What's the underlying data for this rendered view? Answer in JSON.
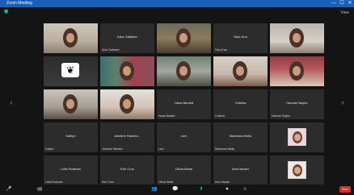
{
  "window": {
    "title": "Zoom Meeting",
    "controls": [
      "—",
      "☐",
      "✕"
    ]
  },
  "topbar": {
    "security_icon": "shield-check-icon",
    "view_label": "View"
  },
  "colors": {
    "titlebar": "#1b5fb8",
    "background": "#141414",
    "tile": "#2c2c2c",
    "end_button": "#d92c2c",
    "security": "#29b36b"
  },
  "grid": {
    "rows": [
      [
        {
          "type": "video",
          "scene": "vid-a",
          "label": ""
        },
        {
          "type": "name",
          "center_name": "Alice Gallaher",
          "label": "Alice Gallaher"
        },
        {
          "type": "video",
          "scene": "vid-b",
          "label": ""
        },
        {
          "type": "name",
          "center_name": "Sara Ena",
          "label": "Sara Ena"
        },
        {
          "type": "video",
          "scene": "vid-c",
          "label": ""
        }
      ],
      [
        {
          "type": "logo",
          "scene": "vid-e",
          "label": ""
        },
        {
          "type": "video",
          "scene": "vid-f",
          "label": ""
        },
        {
          "type": "video",
          "scene": "vid-g",
          "label": ""
        },
        {
          "type": "video",
          "scene": "vid-h",
          "label": ""
        },
        {
          "type": "video",
          "scene": "vid-i",
          "label": ""
        }
      ],
      [
        {
          "type": "video",
          "scene": "vid-j",
          "label": ""
        },
        {
          "type": "video",
          "scene": "vid-k",
          "label": ""
        },
        {
          "type": "name",
          "center_name": "Hana Bartlett",
          "label": "Hana Bartlett"
        },
        {
          "type": "name",
          "center_name": "Cristina",
          "label": "Cristina"
        },
        {
          "type": "name",
          "center_name": "Hannah Baylor",
          "label": "Hannah Baylor"
        }
      ],
      [
        {
          "type": "name",
          "center_name": "Kaitlyn",
          "label": "Kaitlyn"
        },
        {
          "type": "name",
          "center_name": "Joseline Randez...",
          "label": "Joseline Randez"
        },
        {
          "type": "name",
          "center_name": "Lexi",
          "label": "Lexi"
        },
        {
          "type": "name",
          "center_name": "Marianna Wells",
          "label": "Marianna Wells"
        },
        {
          "type": "avatar",
          "avatar_style": "pink",
          "label": ""
        }
      ],
      [
        {
          "type": "name",
          "center_name": "Leila Rodman",
          "label": "Leila Rodman"
        },
        {
          "type": "name",
          "center_name": "Erin Cruz",
          "label": "Erin Cruz"
        },
        {
          "type": "name",
          "center_name": "Olivia Marie",
          "label": "Olivia Marie"
        },
        {
          "type": "name",
          "center_name": "Ana Hauser",
          "label": "Ana Hauser"
        },
        {
          "type": "avatar",
          "avatar_style": "plain",
          "label": ""
        }
      ]
    ]
  },
  "bottombar": {
    "left_buttons": [
      "🎤",
      "📹"
    ],
    "center_buttons": [
      "👥",
      "💬",
      "⬆",
      "⏺",
      "☺"
    ],
    "end_label": "End"
  }
}
